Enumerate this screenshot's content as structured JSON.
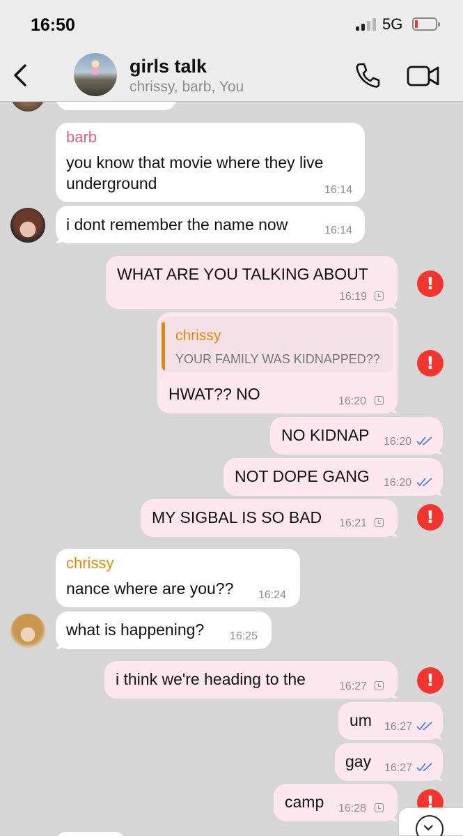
{
  "status_bar": {
    "time": "16:50",
    "network": "5G"
  },
  "header": {
    "title": "girls talk",
    "subtitle": "chrissy, barb, You"
  },
  "messages": [
    {
      "sender": "barb",
      "text_lines": [
        "you know that movie where they live",
        "underground"
      ],
      "time": "16:14"
    },
    {
      "text": "i dont remember the name now",
      "time": "16:14"
    },
    {
      "text": "WHAT ARE YOU TALKING ABOUT",
      "time": "16:19"
    },
    {
      "reply_to": {
        "sender": "chrissy",
        "text": "YOUR FAMILY WAS KIDNAPPED??"
      },
      "text": "HWAT?? NO",
      "time": "16:20"
    },
    {
      "text": "NO KIDNAP",
      "time": "16:20"
    },
    {
      "text": "NOT DOPE GANG",
      "time": "16:20"
    },
    {
      "text": "MY SIGBAL IS SO BAD",
      "time": "16:21"
    },
    {
      "sender": "chrissy",
      "text": "nance where are you??",
      "time": "16:24"
    },
    {
      "text": "what is happening?",
      "time": "16:25"
    },
    {
      "text": "i think we're heading to the",
      "time": "16:27"
    },
    {
      "text": "um",
      "time": "16:27"
    },
    {
      "text": "gay",
      "time": "16:27"
    },
    {
      "text": "camp",
      "time": "16:28"
    }
  ],
  "error_glyph": "!",
  "colors": {
    "chat_background": "#d6d6d6",
    "outgoing_bubble": "#fde7ef",
    "incoming_bubble": "#ffffff",
    "barb_name": "#e0627a",
    "chrissy_name": "#e08a0d",
    "error": "#f2362f",
    "read_ticks": "#4a7fd8"
  },
  "icons": [
    "back-chevron-icon",
    "phone-icon",
    "video-camera-icon",
    "clock-icon",
    "double-check-icon",
    "error-icon",
    "chevron-down-icon"
  ]
}
